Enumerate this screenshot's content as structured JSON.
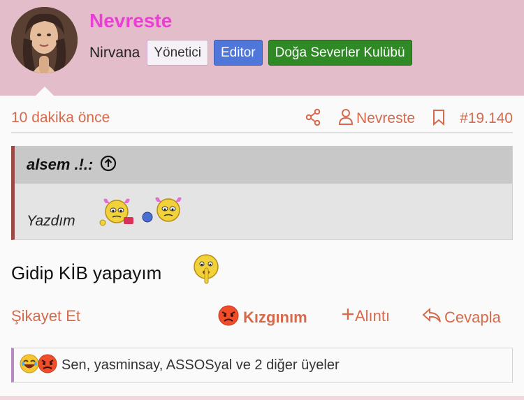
{
  "user": {
    "name": "Nevreste",
    "subtitle": "Nirvana",
    "badges": [
      "Yönetici",
      "Editor",
      "Doğa Severler Kulübü"
    ]
  },
  "post": {
    "time": "10 dakika önce",
    "author": "Nevreste",
    "number": "#19.140",
    "quote": {
      "author": "alsem .!.:",
      "text": "Yazdım"
    },
    "message": "Gidip KİB yapayım"
  },
  "actions": {
    "report": "Şikayet Et",
    "reaction": "Kızgınım",
    "quote": "Alıntı",
    "reply": "Cevapla"
  },
  "reactions_summary": "Sen, yasminsay, ASSOSyal ve 2 diğer üyeler",
  "icons": [
    "share-icon",
    "user-icon",
    "bookmark-icon",
    "arrow-up-circle-icon",
    "angry-face-icon",
    "plus-icon",
    "reply-icon",
    "laughing-face-icon"
  ],
  "colors": {
    "header_bg": "#e4bdcb",
    "username": "#e93fd4",
    "accent": "#d56a4c",
    "badge_editor": "#4f77d9",
    "badge_club": "#2f8a25"
  }
}
